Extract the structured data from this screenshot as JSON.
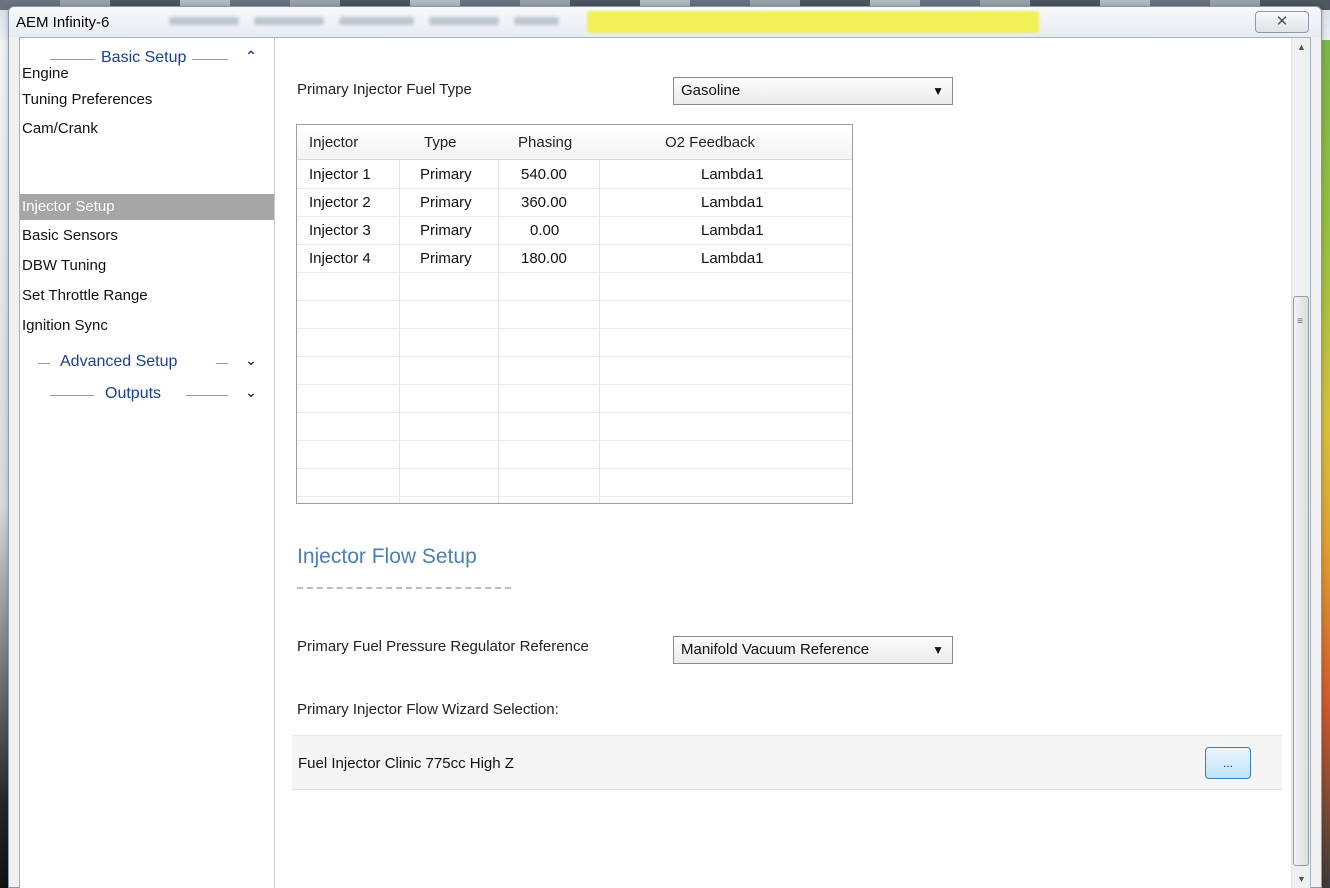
{
  "window": {
    "title": "AEM Infinity-6",
    "close_label": "✕"
  },
  "sidebar": {
    "basic_setup": {
      "label": "Basic Setup",
      "chevron": "⌃"
    },
    "items": [
      {
        "label": "Engine",
        "active": false
      },
      {
        "label": "Tuning Preferences",
        "active": false
      },
      {
        "label": "Cam/Crank",
        "active": false
      },
      {
        "label": "Injector Setup",
        "active": true
      },
      {
        "label": "Basic Sensors",
        "active": false
      },
      {
        "label": "DBW Tuning",
        "active": false
      },
      {
        "label": "Set Throttle Range",
        "active": false
      },
      {
        "label": "Ignition Sync",
        "active": false
      }
    ],
    "advanced_setup": {
      "label": "Advanced Setup",
      "chevron": "⌄"
    },
    "outputs": {
      "label": "Outputs",
      "chevron": "⌄"
    }
  },
  "main": {
    "fuel_type": {
      "label": "Primary Injector Fuel Type",
      "value": "Gasoline",
      "arrow": "▼"
    },
    "injector_table": {
      "columns": [
        "Injector",
        "Type",
        "Phasing",
        "O2 Feedback"
      ],
      "rows": [
        [
          "Injector 1",
          "Primary",
          "540.00",
          "Lambda1"
        ],
        [
          "Injector 2",
          "Primary",
          "360.00",
          "Lambda1"
        ],
        [
          "Injector 3",
          "Primary",
          "0.00",
          "Lambda1"
        ],
        [
          "Injector 4",
          "Primary",
          "180.00",
          "Lambda1"
        ]
      ]
    },
    "flow_setup": {
      "title": "Injector Flow Setup",
      "regulator_label": "Primary Fuel Pressure Regulator Reference",
      "regulator_value": "Manifold Vacuum Reference",
      "regulator_arrow": "▼",
      "wizard_label": "Primary Injector Flow Wizard Selection:",
      "wizard_value": "Fuel Injector Clinic 775cc High Z",
      "browse_label": "..."
    }
  },
  "scrollbar": {
    "up": "▲",
    "down": "▼",
    "grip": "≡"
  }
}
